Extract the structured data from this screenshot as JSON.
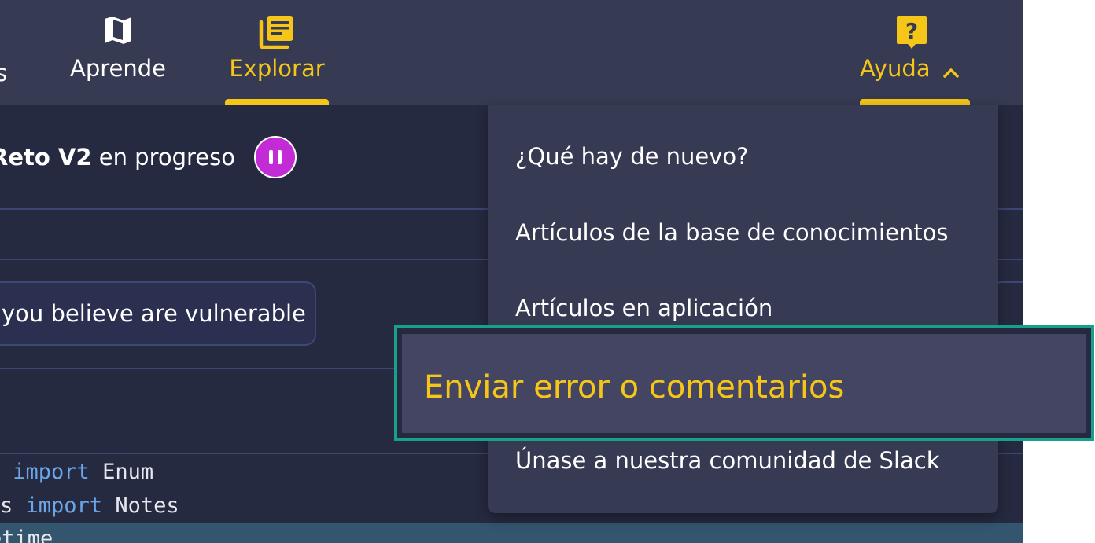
{
  "nav": {
    "items": [
      {
        "label": "s",
        "icon": "",
        "active": false
      },
      {
        "label": "Aprende",
        "icon": "map-icon",
        "active": false
      },
      {
        "label": "Explorar",
        "icon": "book-stack-icon",
        "active": true
      },
      {
        "label": "Ayuda",
        "icon": "help-icon",
        "active": true
      }
    ]
  },
  "status": {
    "bold": "Reto V2",
    "rest": " en progreso"
  },
  "hint": {
    "text": "you believe are vulnerable"
  },
  "code": {
    "line1_prefix": " ",
    "line1_kw": "import",
    "line1_rest": " Enum",
    "line2_prefix": "s ",
    "line2_kw": "import",
    "line2_rest": " Notes",
    "line3": "etime"
  },
  "dropdown": {
    "items": [
      "¿Qué hay de nuevo?",
      "Artículos de la base de conocimientos",
      "Artículos en aplicación",
      "Enviar error o comentarios",
      "Únase a nuestra comunidad de Slack"
    ]
  },
  "colors": {
    "accent": "#f5c518",
    "nav_bg": "#363a52",
    "page_bg": "#262a40",
    "pause": "#c22bd6",
    "highlight_border": "#19a08d"
  }
}
